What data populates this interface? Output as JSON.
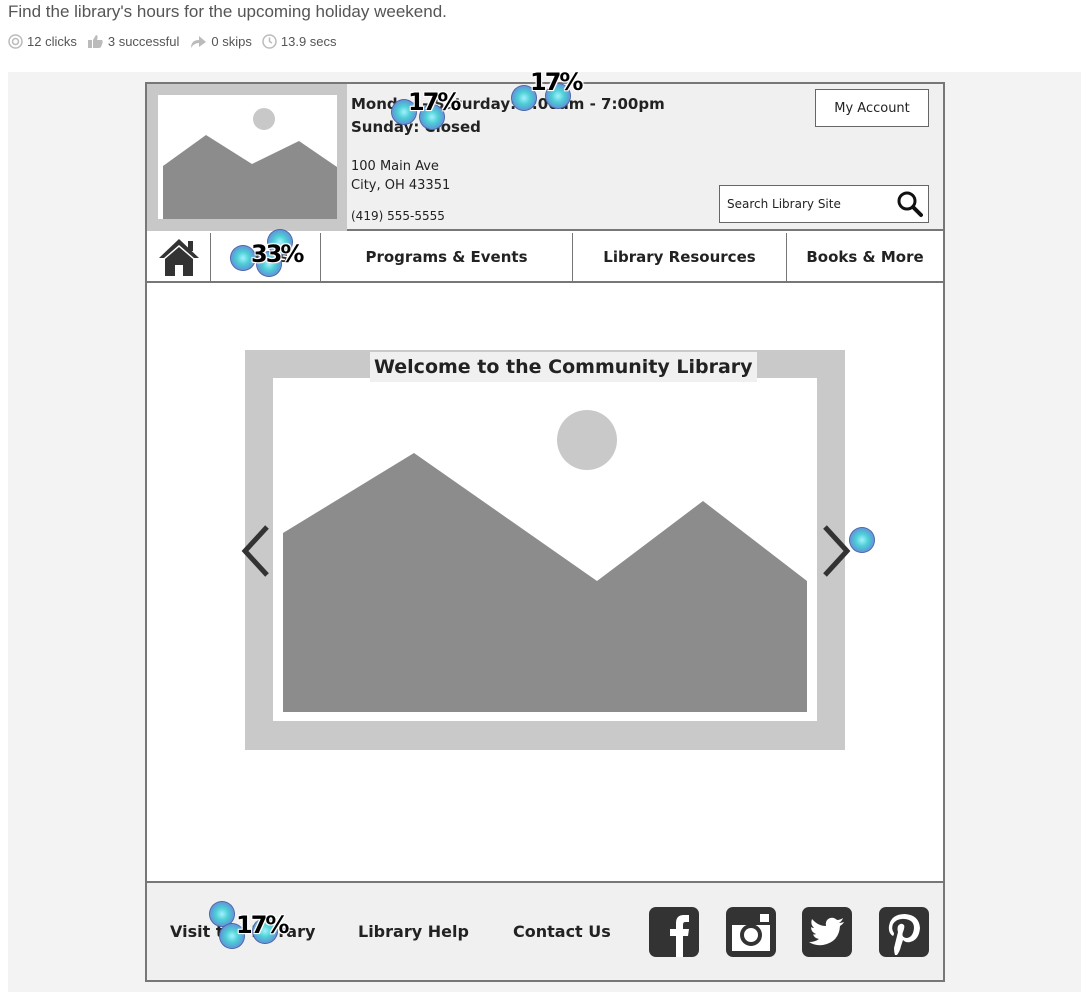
{
  "task": {
    "question": "Find the library's hours for the upcoming holiday weekend.",
    "stats": [
      {
        "icon": "clicks-icon",
        "text": "12 clicks"
      },
      {
        "icon": "thumbs-up-icon",
        "text": "3 successful"
      },
      {
        "icon": "skip-arrow-icon",
        "text": "0 skips"
      },
      {
        "icon": "clock-icon",
        "text": "13.9 secs"
      }
    ]
  },
  "header": {
    "hours_line1": "Monday - Saturday: 8:00am - 7:00pm",
    "hours_line2": "Sunday: Closed",
    "address_line1": "100 Main Ave",
    "address_line2": "City, OH 43351",
    "phone": "(419) 555-5555",
    "account_button": "My Account",
    "search_placeholder": "Search Library Site"
  },
  "nav": {
    "items": [
      "News",
      "Programs & Events",
      "Library Resources",
      "Books & More"
    ]
  },
  "carousel": {
    "title": "Welcome to the Community Library"
  },
  "footer": {
    "links": [
      "Visit the Library",
      "Library Help",
      "Contact Us"
    ],
    "social": [
      "facebook-icon",
      "instagram-icon",
      "twitter-icon",
      "pinterest-icon"
    ]
  },
  "heatmap": {
    "labels": [
      "17%",
      "17%",
      "33%",
      "17%"
    ],
    "colors": {
      "spot": "#4ed1d6",
      "ring": "#5a5aa8"
    }
  },
  "colors": {
    "placeholder_gray": "#c8c8c8",
    "mountain_gray": "#8c8c8c",
    "border": "#777777",
    "icon_dark": "#333333"
  }
}
